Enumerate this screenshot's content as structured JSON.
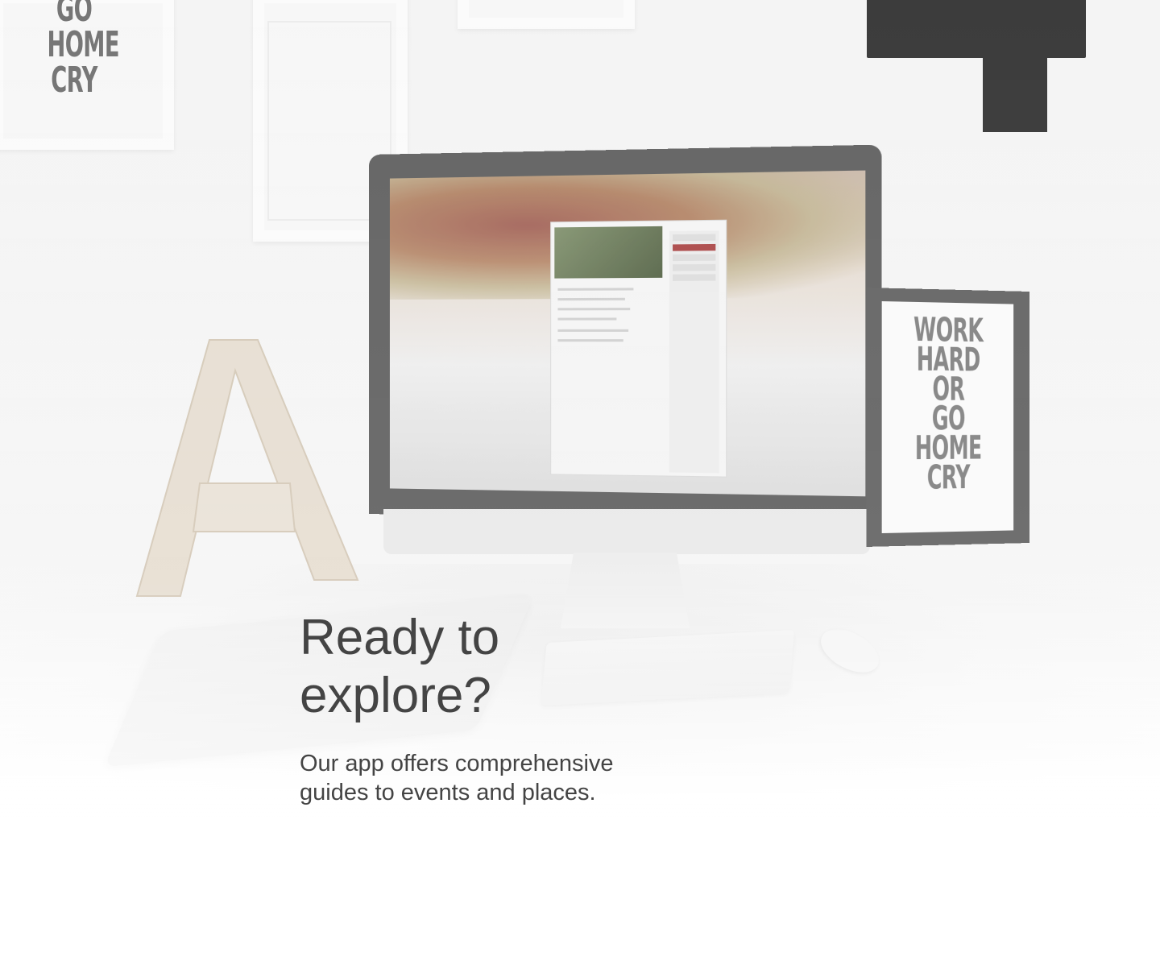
{
  "scene": {
    "left_poster_text": "GO\nHOME\nCRY",
    "right_poster_text": "WORK\nHARD\nOR\nGO\nHOME\nCRY",
    "apple_logo_glyph": ""
  },
  "hero": {
    "title_line_1": "Ready to",
    "title_line_2": "explore?",
    "subtitle_line_1": "Our app offers comprehensive",
    "subtitle_line_2": "guides to events and places."
  },
  "colors": {
    "text": "#444444",
    "background": "#ffffff",
    "poster_frame": "#5c5c5c"
  }
}
